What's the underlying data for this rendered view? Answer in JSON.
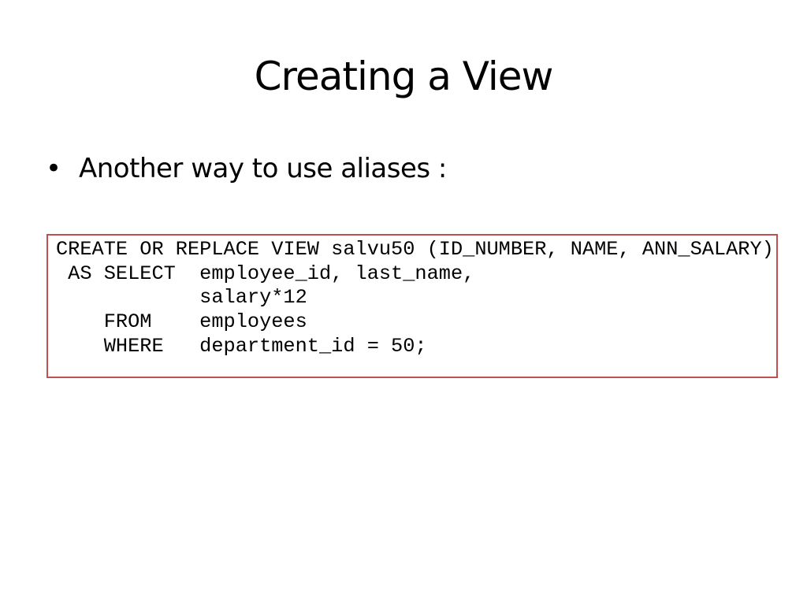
{
  "slide": {
    "title": "Creating a View",
    "bullets": [
      {
        "marker": "•",
        "text": "Another way to use aliases :"
      }
    ],
    "code": {
      "border_color": "#c0504d",
      "lines": [
        "CREATE OR REPLACE VIEW salvu50 (ID_NUMBER, NAME, ANN_SALARY)",
        " AS SELECT  employee_id, last_name,",
        "            salary*12",
        "    FROM    employees",
        "    WHERE   department_id = 50;"
      ]
    }
  }
}
